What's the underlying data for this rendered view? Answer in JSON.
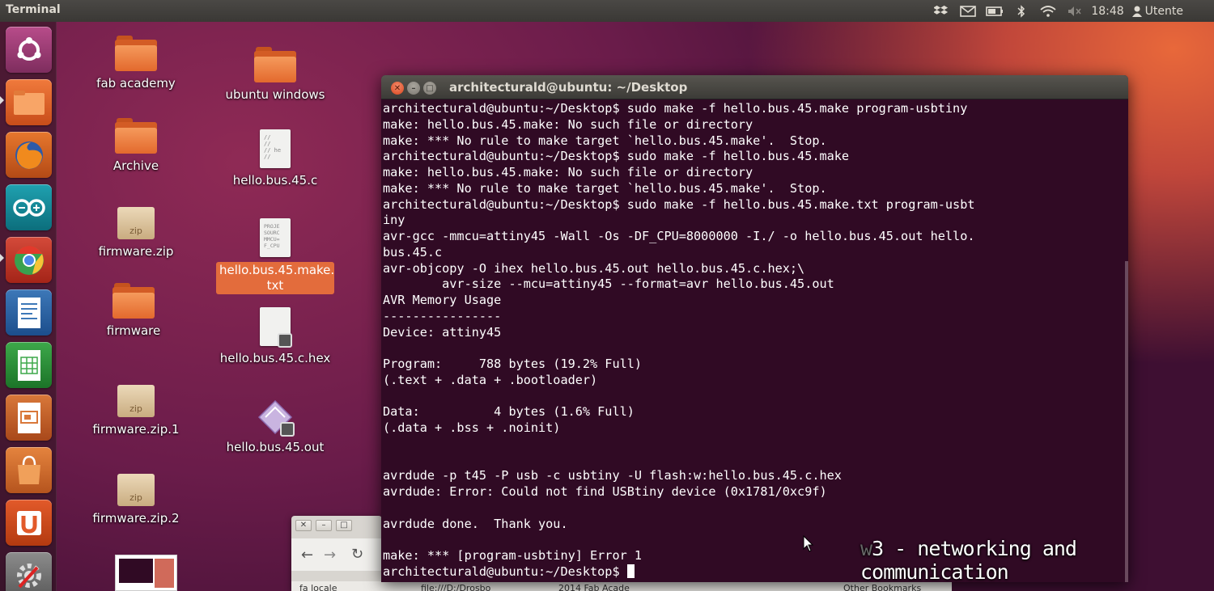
{
  "top_panel": {
    "app_title": "Terminal",
    "clock": "18:48",
    "user": "Utente",
    "indicators": [
      "dropbox-icon",
      "mail-icon",
      "battery-icon",
      "bluetooth-icon",
      "wifi-icon",
      "volume-muted-icon"
    ]
  },
  "launcher": {
    "items": [
      "ubuntu-dash",
      "files",
      "firefox",
      "arduino",
      "chrome",
      "libreoffice-writer",
      "libreoffice-calc",
      "libreoffice-impress",
      "ubuntu-software-center",
      "ubuntu-one",
      "system-settings"
    ]
  },
  "desktop": {
    "icons": [
      {
        "label": "fab academy",
        "type": "folder"
      },
      {
        "label": "Archive",
        "type": "folder"
      },
      {
        "label": "firmware.zip",
        "type": "zip"
      },
      {
        "label": "firmware",
        "type": "folder"
      },
      {
        "label": "firmware.zip.1",
        "type": "zip"
      },
      {
        "label": "firmware.zip.2",
        "type": "zip"
      },
      {
        "label": "ubuntu windows",
        "type": "folder"
      },
      {
        "label": "hello.bus.45.c",
        "type": "text"
      },
      {
        "label": "hello.bus.45.make.\ntxt",
        "type": "text",
        "selected": true
      },
      {
        "label": "hello.bus.45.c.hex",
        "type": "locked"
      },
      {
        "label": "hello.bus.45.out",
        "type": "binary"
      }
    ],
    "zip_glyph_text": "zip",
    "c_file_preview": "//\n//\n// he\n//",
    "make_file_preview": "PROJE\nSOURC\nMMCU=\nF_CPU"
  },
  "terminal": {
    "title": "architecturald@ubuntu: ~/Desktop",
    "lines": [
      "architecturald@ubuntu:~/Desktop$ sudo make -f hello.bus.45.make program-usbtiny",
      "make: hello.bus.45.make: No such file or directory",
      "make: *** No rule to make target `hello.bus.45.make'.  Stop.",
      "architecturald@ubuntu:~/Desktop$ sudo make -f hello.bus.45.make",
      "make: hello.bus.45.make: No such file or directory",
      "make: *** No rule to make target `hello.bus.45.make'.  Stop.",
      "architecturald@ubuntu:~/Desktop$ sudo make -f hello.bus.45.make.txt program-usbt",
      "iny",
      "avr-gcc -mmcu=attiny45 -Wall -Os -DF_CPU=8000000 -I./ -o hello.bus.45.out hello.",
      "bus.45.c",
      "avr-objcopy -O ihex hello.bus.45.out hello.bus.45.c.hex;\\",
      "        avr-size --mcu=attiny45 --format=avr hello.bus.45.out",
      "AVR Memory Usage",
      "----------------",
      "Device: attiny45",
      "",
      "Program:     788 bytes (19.2% Full)",
      "(.text + .data + .bootloader)",
      "",
      "Data:          4 bytes (1.6% Full)",
      "(.data + .bss + .noinit)",
      "",
      "",
      "avrdude -p t45 -P usb -c usbtiny -U flash:w:hello.bus.45.c.hex",
      "avrdude: Error: Could not find USBtiny device (0x1781/0xc9f)",
      "",
      "avrdude done.  Thank you.",
      "",
      "make: *** [program-usbtiny] Error 1"
    ],
    "prompt": "architecturald@ubuntu:~/Desktop$ "
  },
  "browser": {
    "bookmarks": [
      "fa locale",
      "file:///D:/Drosbo",
      "2014 Fab Acade",
      "Other Bookmarks"
    ]
  },
  "overlay": {
    "prefix": "w",
    "caption": "3 - networking and communication"
  }
}
